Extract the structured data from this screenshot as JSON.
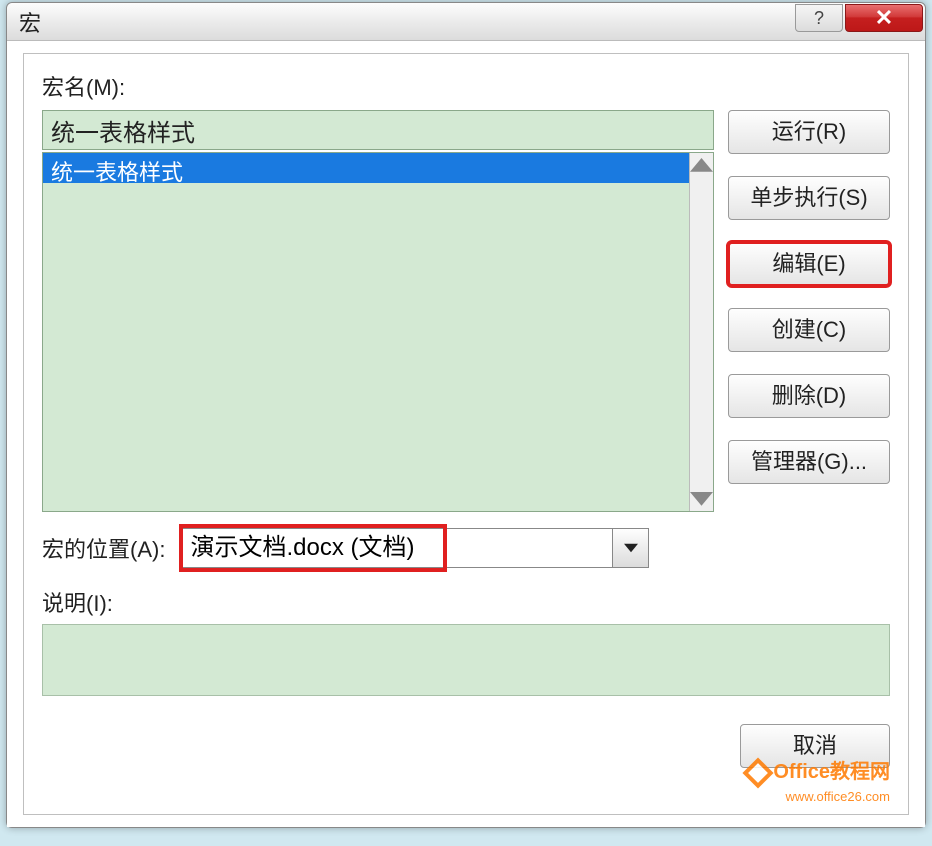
{
  "title": "宏",
  "titlebar": {
    "help_tooltip": "?",
    "close_tooltip": "✕"
  },
  "labels": {
    "macro_name": "宏名(M):",
    "macro_location": "宏的位置(A):",
    "description": "说明(I):"
  },
  "inputs": {
    "macro_name_value": "统一表格样式",
    "location_value": "演示文档.docx (文档)",
    "description_value": ""
  },
  "macro_list": {
    "items": [
      "统一表格样式"
    ],
    "selected_index": 0
  },
  "buttons": {
    "run": "运行(R)",
    "step": "单步执行(S)",
    "edit": "编辑(E)",
    "create": "创建(C)",
    "delete": "删除(D)",
    "organizer": "管理器(G)...",
    "cancel": "取消"
  },
  "watermark": {
    "line1": "Office教程网",
    "line2": "www.office26.com"
  }
}
